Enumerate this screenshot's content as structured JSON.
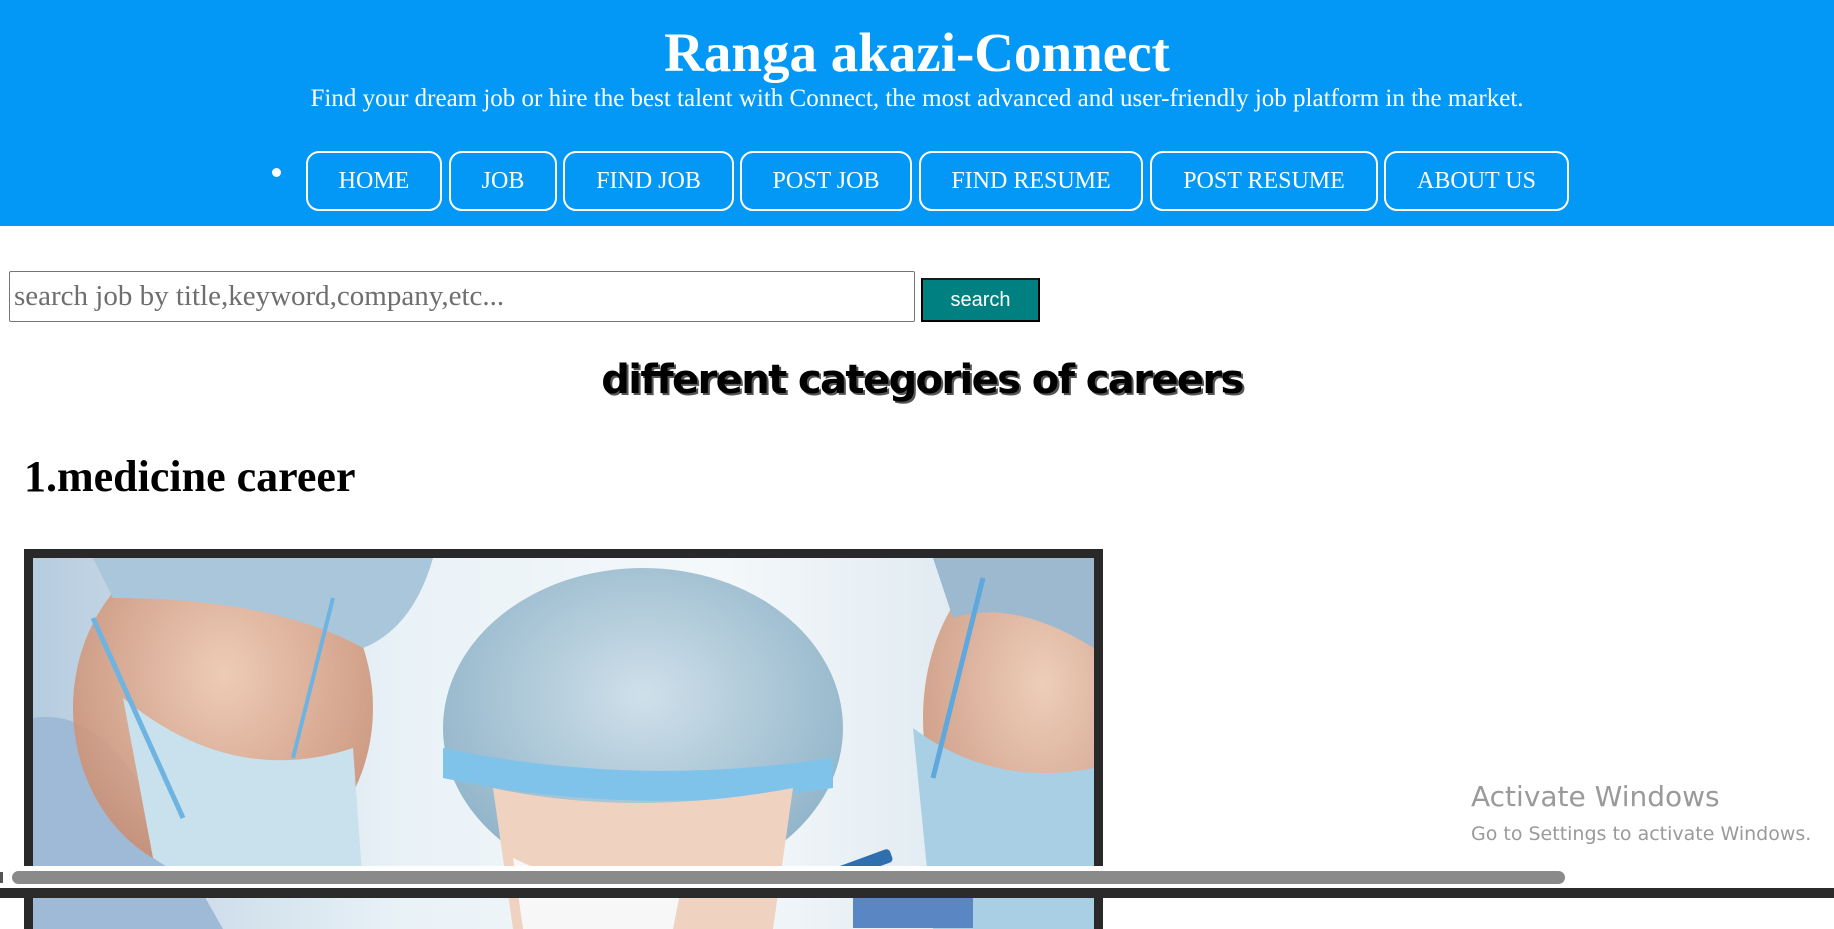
{
  "header": {
    "title": "Ranga akazi-Connect",
    "tagline": "Find your dream job or hire the best talent with Connect, the most advanced and user-friendly job platform in the market."
  },
  "nav": {
    "items": [
      {
        "label": "HOME"
      },
      {
        "label": "JOB"
      },
      {
        "label": "FIND JOB"
      },
      {
        "label": "POST JOB"
      },
      {
        "label": "FIND RESUME"
      },
      {
        "label": "POST RESUME"
      },
      {
        "label": "ABOUT US"
      }
    ]
  },
  "search": {
    "placeholder": "search job by title,keyword,company,etc...",
    "value": "",
    "button_label": "search"
  },
  "main": {
    "categories_heading": "different categories of careers",
    "sections": [
      {
        "title": "1.medicine career"
      }
    ]
  },
  "watermark": {
    "title": "Activate Windows",
    "subtitle": "Go to Settings to activate Windows."
  },
  "colors": {
    "header_bg": "#0398f5",
    "search_button_bg": "#008080",
    "image_border": "#292929"
  }
}
